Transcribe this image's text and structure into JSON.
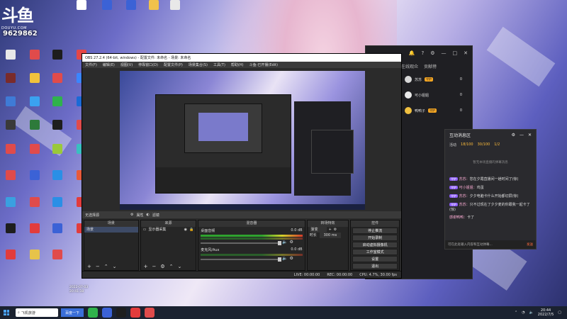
{
  "desktop": {
    "logo_text": "斗鱼",
    "logo_url": "DOUYU.COM",
    "room_number": "9629862",
    "icons": [
      {
        "label": "",
        "color": "#ffffff"
      },
      {
        "label": "",
        "color": "#3b62d6"
      },
      {
        "label": "",
        "color": "#3b62d6"
      },
      {
        "label": "",
        "color": "#f1c24b"
      },
      {
        "label": "",
        "color": "#e8e8e8"
      },
      {
        "label": "",
        "color": "#e8e8e8"
      },
      {
        "label": "",
        "color": "#e04b4b"
      },
      {
        "label": "",
        "color": "#1d1d1d"
      },
      {
        "label": "",
        "color": "#e44646"
      },
      {
        "label": "",
        "color": "#7a2b2b"
      },
      {
        "label": "",
        "color": "#f0c23c"
      },
      {
        "label": "",
        "color": "#e04b4b"
      },
      {
        "label": "",
        "color": "#3a86ff"
      },
      {
        "label": "",
        "color": "#3f7bd6"
      },
      {
        "label": "",
        "color": "#3aa2f0"
      },
      {
        "label": "",
        "color": "#2fb24c"
      },
      {
        "label": "",
        "color": "#1b6ad6"
      },
      {
        "label": "",
        "color": "#3a3a3a"
      },
      {
        "label": "",
        "color": "#2d7a3a"
      },
      {
        "label": "",
        "color": "#1e1e1e"
      },
      {
        "label": "",
        "color": "#e04b4b"
      },
      {
        "label": "",
        "color": "#e04b4b"
      },
      {
        "label": "",
        "color": "#e04b4b"
      },
      {
        "label": "",
        "color": "#9ac93a"
      },
      {
        "label": "",
        "color": "#39c0c0"
      },
      {
        "label": "",
        "color": "#e04b4b"
      },
      {
        "label": "",
        "color": "#3b62d6"
      },
      {
        "label": "",
        "color": "#2a8fe6"
      },
      {
        "label": "",
        "color": "#e85a3a"
      },
      {
        "label": "",
        "color": "#3aa0e0"
      },
      {
        "label": "",
        "color": "#e04b4b"
      },
      {
        "label": "",
        "color": "#2a8fe6"
      },
      {
        "label": "",
        "color": "#e23c3c"
      },
      {
        "label": "",
        "color": "#1e1e1e"
      },
      {
        "label": "",
        "color": "#e23c3c"
      },
      {
        "label": "",
        "color": "#3b62d6"
      },
      {
        "label": "",
        "color": "#e23c3c"
      },
      {
        "label": "",
        "color": "#e23c3c"
      },
      {
        "label": "",
        "color": "#e7c34a"
      },
      {
        "label": "",
        "color": "#e04b4b"
      }
    ],
    "bottom_time": "2022-07-03\n20:41:38"
  },
  "douyu_app": {
    "title_tab": "在线观众",
    "tab2": "贡献榜",
    "viewers": [
      {
        "name": "苏苏",
        "tag": "守护",
        "num": "0",
        "color": "#d8d8d8"
      },
      {
        "name": "可小姐姐",
        "tag": "",
        "num": "0",
        "color": "#eaeaea"
      },
      {
        "name": "鸭鸭子",
        "tag": "守护",
        "num": "0",
        "color": "#f0c040"
      }
    ]
  },
  "obs": {
    "title": "OBS 27.2.4 (64-bit, windows) - 配置文件: 未命名 - 场景: 未命名",
    "menu": [
      "文件(F)",
      "编辑(E)",
      "视图(V)",
      "停靠窗口(D)",
      "配置文件(P)",
      "场景集合(S)",
      "工具(T)",
      "帮助(H)",
      "斗鱼-已开播(Edit)"
    ],
    "scene_bar": "无选择源",
    "scene_bar_props": "属性",
    "scene_bar_filters": "滤镜",
    "docks": {
      "scenes": {
        "title": "场景",
        "items": [
          "场景"
        ]
      },
      "sources": {
        "title": "来源",
        "items": [
          "显示器采集"
        ]
      },
      "mixer": {
        "title": "混音器",
        "tracks": [
          {
            "name": "桌面音频",
            "db": "0.0 dB"
          },
          {
            "name": "麦克风/Aux",
            "db": "0.0 dB"
          }
        ]
      },
      "transitions": {
        "title": "转场特效",
        "mode": "渐变",
        "duration_label": "时长",
        "duration": "300 ms"
      },
      "controls": {
        "title": "控件",
        "buttons": [
          "停止推流",
          "开始录制",
          "启动虚拟摄像机",
          "工作室模式",
          "设置",
          "退出"
        ]
      }
    },
    "status": {
      "live": "LIVE: 00:00:00",
      "rec": "REC: 00:00:00",
      "cpu": "CPU: 4.7%, 30.00 fps"
    }
  },
  "chat": {
    "title": "互动消息区",
    "stats": [
      "活动",
      "18/100",
      "30/100",
      "1/2"
    ],
    "system_text": "暂无本场直播的弹幕消息",
    "messages": [
      {
        "lv": "守护",
        "name": "苏苏：",
        "text": "您在夕霞直播间一趟时间了(惊)"
      },
      {
        "lv": "守护",
        "name": "可小姐姐：",
        "text": "鸡蛋"
      },
      {
        "lv": "守护",
        "name": "苏苏：",
        "text": "夕夕电脑卡什么开始都切屏(惊)"
      },
      {
        "lv": "守护",
        "name": "苏苏：",
        "text": "只不过现在了夕夕麦的你跟我一起卡了(惊)"
      },
      {
        "lv": "",
        "name": "感谢鸭鸭：",
        "text": "卡了"
      }
    ],
    "input_placeholder": "可在此处输入内容和互动弹幕...",
    "send_label": "发送"
  },
  "taskbar": {
    "search_text": "飞机旅游",
    "active_btn": "百度一下",
    "apps": [
      "#2fb24c",
      "#3b62d6",
      "#1e1e1e",
      "#e23c3c",
      "#e04b4b"
    ],
    "tray_time": "20:44",
    "tray_date": "2022/7/5"
  }
}
